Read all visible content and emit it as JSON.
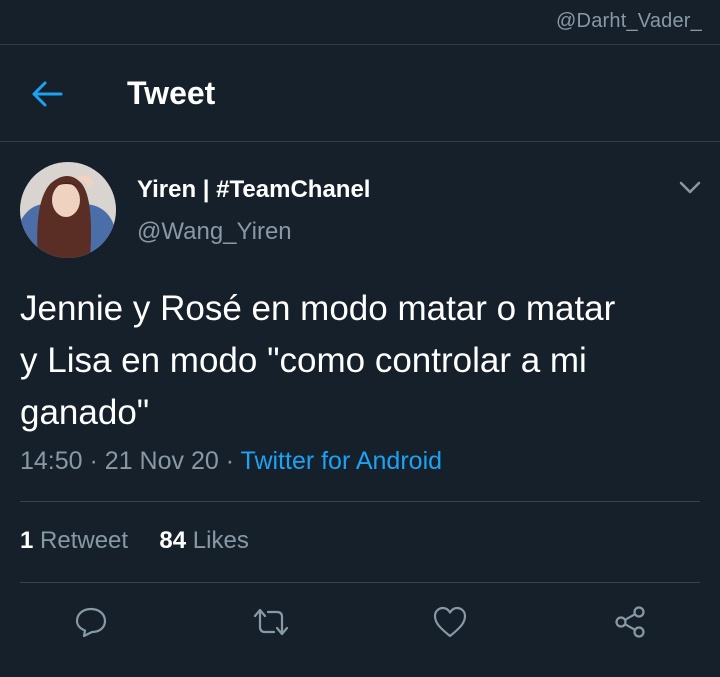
{
  "watermark": "@Darht_Vader_",
  "header": {
    "back_icon": "arrow-left-icon",
    "title": "Tweet"
  },
  "tweet": {
    "author": {
      "name": "Yiren | #TeamChanel",
      "handle": "@Wang_Yiren"
    },
    "text_lines": [
      "Jennie y Rosé en modo matar o matar",
      "y Lisa en modo \"como controlar a mi",
      "ganado\""
    ],
    "time": "14:50",
    "separator": "·",
    "date": "21 Nov 20",
    "source": "Twitter for Android",
    "stats": {
      "retweets_count": "1",
      "retweets_label": "Retweet",
      "likes_count": "84",
      "likes_label": "Likes"
    },
    "actions": [
      "reply-icon",
      "retweet-icon",
      "like-icon",
      "share-icon"
    ]
  },
  "colors": {
    "background": "#15202b",
    "accent": "#1da1f2",
    "secondary_text": "#8899a6",
    "divider": "#38444d"
  }
}
